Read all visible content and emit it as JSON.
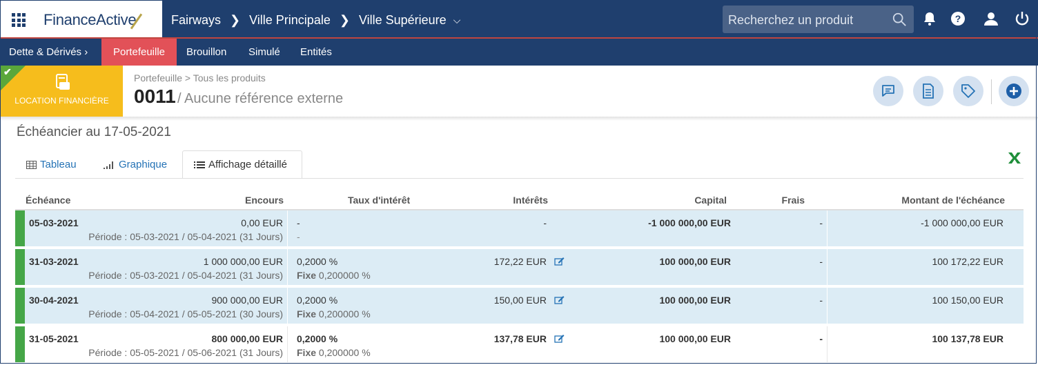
{
  "app": {
    "logo_text_1": "Finance",
    "logo_text_2": "Active",
    "breadcrumb": [
      "Fairways",
      "Ville Principale",
      "Ville Supérieure"
    ],
    "search_placeholder": "Recherchez un produit"
  },
  "nav": {
    "items": [
      "Dette & Dérivés",
      "Portefeuille",
      "Brouillon",
      "Simulé",
      "Entités"
    ],
    "active": "Portefeuille"
  },
  "product": {
    "badge_label": "LOCATION FINANCIÈRE",
    "breadcrumb": "Portefeuille > Tous les produits",
    "id": "0011",
    "external_ref": "/ Aucune référence externe"
  },
  "section": {
    "title": "Échéancier au 17-05-2021",
    "tabs": [
      "Tableau",
      "Graphique",
      "Affichage détaillé"
    ],
    "active_tab": "Affichage détaillé"
  },
  "table": {
    "headers": [
      "Échéance",
      "Encours",
      "Taux d'intérêt",
      "Intérêts",
      "Capital",
      "Frais",
      "Montant de l'échéance"
    ],
    "rows": [
      {
        "date": "05-03-2021",
        "encours": "0,00 EUR",
        "periode": "Période : 05-03-2021 / 05-04-2021 (31 Jours)",
        "taux": "-",
        "taux_type": "",
        "taux_fixe": "-",
        "interets": "-",
        "capital": "-1 000 000,00 EUR",
        "frais": "-",
        "montant": "-1 000 000,00 EUR"
      },
      {
        "date": "31-03-2021",
        "encours": "1 000 000,00 EUR",
        "periode": "Période : 05-03-2021 / 05-04-2021 (31 Jours)",
        "taux": "0,2000 %",
        "taux_type": "Fixe",
        "taux_fixe": "0,200000 %",
        "interets": "172,22 EUR",
        "capital": "100 000,00 EUR",
        "frais": "-",
        "montant": "100 172,22 EUR"
      },
      {
        "date": "30-04-2021",
        "encours": "900 000,00 EUR",
        "periode": "Période : 05-04-2021 / 05-05-2021 (30 Jours)",
        "taux": "0,2000 %",
        "taux_type": "Fixe",
        "taux_fixe": "0,200000 %",
        "interets": "150,00 EUR",
        "capital": "100 000,00 EUR",
        "frais": "-",
        "montant": "100 150,00 EUR"
      },
      {
        "date": "31-05-2021",
        "encours": "800 000,00 EUR",
        "periode": "Période : 05-05-2021 / 05-06-2021 (31 Jours)",
        "taux": "0,2000 %",
        "taux_type": "Fixe",
        "taux_fixe": "0,200000 %",
        "interets": "137,78 EUR",
        "capital": "100 000,00 EUR",
        "frais": "-",
        "montant": "100 137,78 EUR"
      }
    ]
  },
  "colors": {
    "navy": "#1f3f6e",
    "active_tab": "#e25158",
    "badge": "#f6bd1c",
    "row_bg": "#dcecf5",
    "row_bar": "#45a647",
    "link": "#2472b5"
  }
}
